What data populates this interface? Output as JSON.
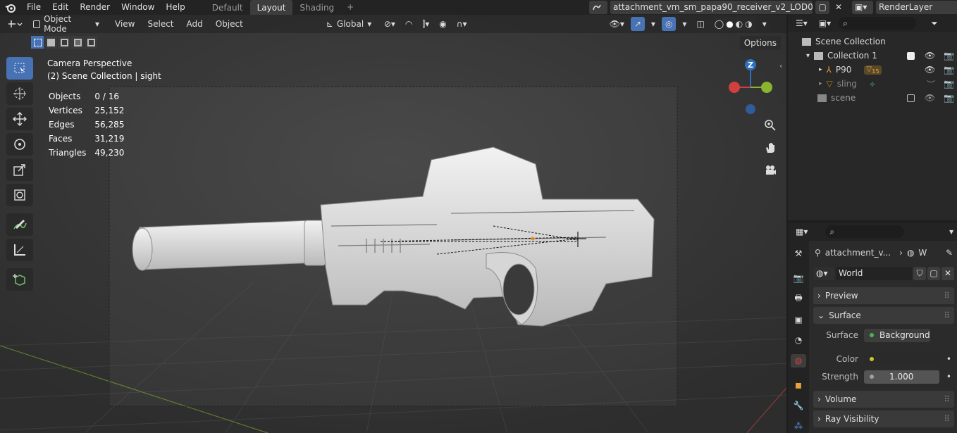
{
  "menubar": {
    "items": [
      "File",
      "Edit",
      "Render",
      "Window",
      "Help"
    ]
  },
  "workspaces": {
    "tabs": [
      "Default",
      "Layout",
      "Shading"
    ],
    "active": "Layout"
  },
  "scene": {
    "name": "attachment_vm_sm_papa90_receiver_v2_LOD0",
    "view_layer": "RenderLayer"
  },
  "viewport": {
    "mode": "Object Mode",
    "menus": [
      "View",
      "Select",
      "Add",
      "Object"
    ],
    "orientation": "Global",
    "options_label": "Options",
    "title": "Camera Perspective",
    "subtitle": "(2) Scene Collection | sight",
    "stats": [
      {
        "label": "Objects",
        "value": "0 / 16"
      },
      {
        "label": "Vertices",
        "value": "25,152"
      },
      {
        "label": "Edges",
        "value": "56,285"
      },
      {
        "label": "Faces",
        "value": "31,219"
      },
      {
        "label": "Triangles",
        "value": "49,230"
      }
    ],
    "gizmo_label": "Z"
  },
  "outliner": {
    "items": [
      {
        "label": "Scene Collection"
      },
      {
        "label": "Collection 1"
      },
      {
        "label": "P90",
        "badge": "15"
      },
      {
        "label": "sling"
      },
      {
        "label": "scene"
      }
    ]
  },
  "properties": {
    "breadcrumb": [
      "attachment_v...",
      "W"
    ],
    "world_name": "World",
    "panels": {
      "preview": "Preview",
      "surface": "Surface",
      "volume": "Volume",
      "ray_visibility": "Ray Visibility"
    },
    "fields": {
      "surface_label": "Surface",
      "surface_value": "Background",
      "color_label": "Color",
      "strength_label": "Strength",
      "strength_value": "1.000"
    }
  },
  "colors": {
    "accent": "#4772b3",
    "axis_x": "#d04040",
    "axis_y": "#8ab52e",
    "axis_z": "#2f6fbf",
    "active_tab": "#3d3d3d"
  }
}
